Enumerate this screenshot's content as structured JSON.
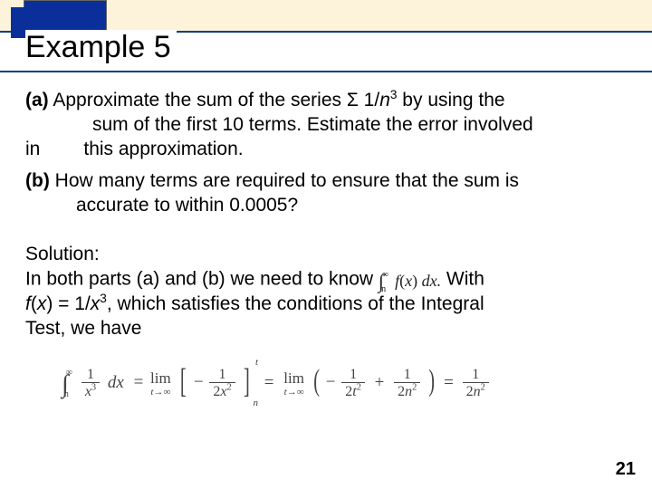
{
  "header": {
    "title": "Example 5"
  },
  "body": {
    "part_a_label": "(a)",
    "part_a_line1_1": " Approximate the sum of the series ",
    "part_a_sigma": "Σ",
    "part_a_line1_2": " 1/",
    "part_a_var": "n",
    "part_a_exp": "3",
    "part_a_line1_3": " by using the",
    "part_a_line2": "sum of the first 10 terms. Estimate the error involved",
    "part_a_in": "in",
    "part_a_line3": "this approximation.",
    "part_b_label": "(b)",
    "part_b_line1": " How many terms are required to ensure that the sum is",
    "part_b_line2": "accurate to within 0.0005?"
  },
  "solution": {
    "heading": "Solution:",
    "line1_1": "In both parts (a) and (b) we need to know ",
    "integral_inline": {
      "upper": "∞",
      "lower": "n",
      "integrand_f": "f",
      "integrand_open": "(",
      "integrand_x": "x",
      "integrand_close": ")",
      "dx": " dx."
    },
    "line1_2": " With",
    "line2_1": "f",
    "line2_open": "(",
    "line2_x": "x",
    "line2_close": ")",
    "line2_2": " = 1/",
    "line2_x2": "x",
    "line2_exp": "3",
    "line2_3": ", which satisfies the conditions of the Integral",
    "line3": "Test, we have"
  },
  "equation": {
    "int_upper": "∞",
    "int_lower": "n",
    "frac1_num": "1",
    "frac1_den_x": "x",
    "frac1_den_exp": "3",
    "dx": "dx",
    "eq": "=",
    "lim_word": "lim",
    "lim_sub": "t→∞",
    "minus": "−",
    "frac2_num": "1",
    "frac2_den_2": "2",
    "frac2_den_x": "x",
    "frac2_den_exp": "2",
    "br_sup": "t",
    "br_sub": "n",
    "frac3_num": "1",
    "frac3_den_2": "2",
    "frac3_den_t": "t",
    "frac3_den_exp": "2",
    "plus": "+",
    "frac4_num": "1",
    "frac4_den_2": "2",
    "frac4_den_n": "n",
    "frac4_den_exp": "2",
    "frac5_num": "1",
    "frac5_den_2": "2",
    "frac5_den_n": "n",
    "frac5_den_exp": "2"
  },
  "page_number": "21"
}
